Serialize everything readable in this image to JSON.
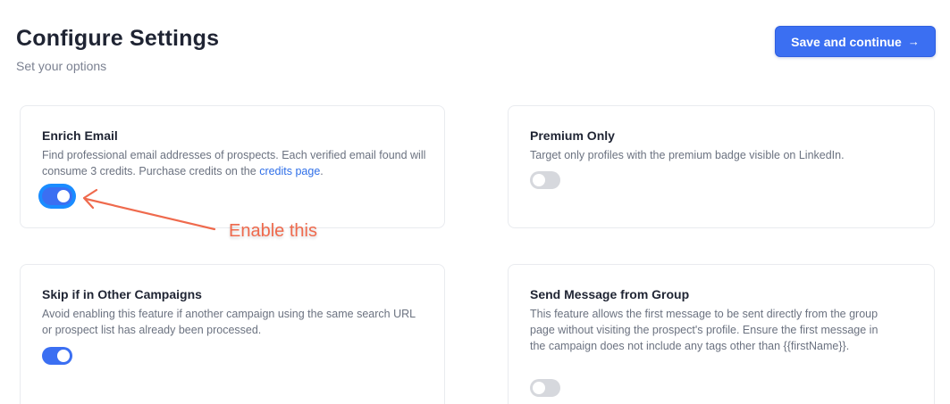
{
  "header": {
    "title": "Configure Settings",
    "subtitle": "Set your options",
    "save_label": "Save and continue",
    "save_arrow": "→"
  },
  "cards": [
    {
      "title": "Enrich Email",
      "desc_before": "Find professional email addresses of prospects. Each verified email found will consume 3 credits. Purchase credits on the ",
      "desc_link": "credits page",
      "desc_after": ".",
      "enabled": true
    },
    {
      "title": "Premium Only",
      "desc": "Target only profiles with the premium badge visible on LinkedIn.",
      "enabled": false
    },
    {
      "title": "Skip if in Other Campaigns",
      "desc": "Avoid enabling this feature if another campaign using the same search URL or prospect list has already been processed.",
      "enabled": true
    },
    {
      "title": "Send Message from Group",
      "desc": "This feature allows the first message to be sent directly from the group page without visiting the prospect's profile. Ensure the first message in the campaign does not include any tags other than {{firstName}}.",
      "enabled": false
    }
  ],
  "annotation": {
    "text": "Enable this"
  },
  "colors": {
    "accent": "#3b6ff2",
    "link": "#2f6fe8",
    "annotation": "#ef6a4d",
    "highlight_ring": "#1a8cff"
  }
}
